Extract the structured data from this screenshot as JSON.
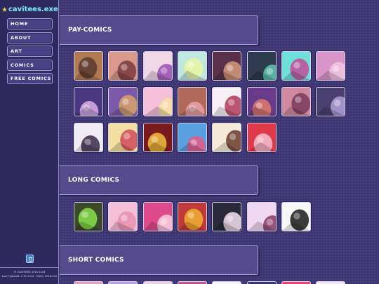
{
  "site": {
    "logo_text": "cavitees.exe"
  },
  "nav": [
    {
      "label": "HOME"
    },
    {
      "label": "ABOUT"
    },
    {
      "label": "ART"
    },
    {
      "label": "COMICS"
    },
    {
      "label": "FREE COMICS"
    }
  ],
  "footer": {
    "copyright": "© CAVITEES 2016-2024",
    "updated": "Last Updated: 2-10-2025 · Visits: 0514,992"
  },
  "sections": [
    {
      "title": "PAY-COMICS",
      "thumbs": [
        {
          "bg": "#b07a55",
          "accent": "#5a3a2e"
        },
        {
          "bg": "#d99a8c",
          "accent": "#7a3b3a"
        },
        {
          "bg": "#f0d8e6",
          "accent": "#9a4db0"
        },
        {
          "bg": "#bfe8e0",
          "accent": "#e9f5a0"
        },
        {
          "bg": "#5a2f4a",
          "accent": "#d39a7a"
        },
        {
          "bg": "#2e3a4e",
          "accent": "#5ec9b0"
        },
        {
          "bg": "#6ee0d8",
          "accent": "#c44a9e"
        },
        {
          "bg": "#d896c8",
          "accent": "#f2c7e0"
        },
        {
          "bg": "#4a3880",
          "accent": "#d8b0e8"
        },
        {
          "bg": "#7a5aa8",
          "accent": "#d8a26a"
        },
        {
          "bg": "#f6c0d8",
          "accent": "#f4e0a0"
        },
        {
          "bg": "#b06a5a",
          "accent": "#e8a0a8"
        },
        {
          "bg": "#f8f0f4",
          "accent": "#b03a5a"
        },
        {
          "bg": "#6a3a8a",
          "accent": "#e07a6a"
        },
        {
          "bg": "#d08aa0",
          "accent": "#7a3a5a"
        },
        {
          "bg": "#4a4070",
          "accent": "#b0a0d8"
        },
        {
          "bg": "#f0ecf4",
          "accent": "#3a2a4a"
        },
        {
          "bg": "#f4e0a0",
          "accent": "#d04a5a"
        },
        {
          "bg": "#7a1a1a",
          "accent": "#f0c040"
        },
        {
          "bg": "#5aa0e0",
          "accent": "#e85a8a"
        },
        {
          "bg": "#f4ecd8",
          "accent": "#6a3a2a"
        },
        {
          "bg": "#e03a4a",
          "accent": "#f4c0d0"
        }
      ]
    },
    {
      "title": "LONG COMICS",
      "thumbs": [
        {
          "bg": "#3a4a2a",
          "accent": "#8ae04a"
        },
        {
          "bg": "#f4c0d8",
          "accent": "#e890b0"
        },
        {
          "bg": "#e04a8a",
          "accent": "#f8d0e0"
        },
        {
          "bg": "#c03a3a",
          "accent": "#f0b030"
        },
        {
          "bg": "#2a2a3a",
          "accent": "#f4e0f0"
        },
        {
          "bg": "#f0d8f0",
          "accent": "#8a3a6a"
        },
        {
          "bg": "#f8f8f8",
          "accent": "#1a1a1a"
        }
      ]
    },
    {
      "title": "SHORT COMICS",
      "thumbs": []
    }
  ]
}
